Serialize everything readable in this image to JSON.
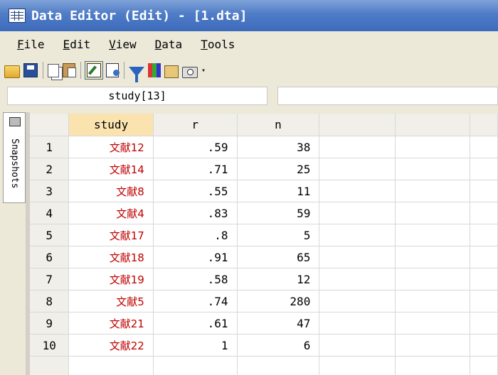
{
  "window": {
    "title": "Data Editor (Edit) - [1.dta]"
  },
  "menu": [
    {
      "key": "F",
      "rest": "ile"
    },
    {
      "key": "E",
      "rest": "dit"
    },
    {
      "key": "V",
      "rest": "iew"
    },
    {
      "key": "D",
      "rest": "ata"
    },
    {
      "key": "T",
      "rest": "ools"
    }
  ],
  "toolbar": {
    "icons": [
      "open-icon",
      "save-icon",
      "copy-icon",
      "paste-icon",
      "edit-mode-icon",
      "browse-mode-icon",
      "filter-icon",
      "variables-icon",
      "properties-icon",
      "snapshot-icon"
    ],
    "active": "edit-mode-icon"
  },
  "cellbar": {
    "reference": "study[13]",
    "value": ""
  },
  "snapshots": {
    "label": "Snapshots"
  },
  "grid": {
    "columns": [
      "study",
      "r",
      "n"
    ],
    "selected_column": "study",
    "rows": [
      {
        "num": "1",
        "study": "文献12",
        "r": ".59",
        "n": "38"
      },
      {
        "num": "2",
        "study": "文献14",
        "r": ".71",
        "n": "25"
      },
      {
        "num": "3",
        "study": "文献8",
        "r": ".55",
        "n": "11"
      },
      {
        "num": "4",
        "study": "文献4",
        "r": ".83",
        "n": "59"
      },
      {
        "num": "5",
        "study": "文献17",
        "r": ".8",
        "n": "5"
      },
      {
        "num": "6",
        "study": "文献18",
        "r": ".91",
        "n": "65"
      },
      {
        "num": "7",
        "study": "文献19",
        "r": ".58",
        "n": "12"
      },
      {
        "num": "8",
        "study": "文献5",
        "r": ".74",
        "n": "280"
      },
      {
        "num": "9",
        "study": "文献21",
        "r": ".61",
        "n": "47"
      },
      {
        "num": "10",
        "study": "文献22",
        "r": "1",
        "n": "6"
      }
    ]
  }
}
